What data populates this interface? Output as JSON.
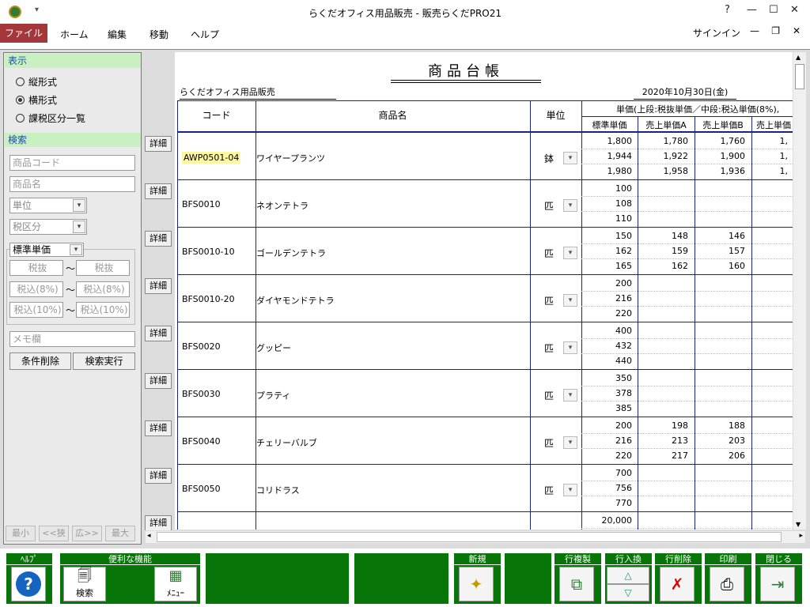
{
  "app": {
    "title": "らくだオフィス用品販売 - 販売らくだPRO21"
  },
  "ribbon": {
    "tabs": [
      "ファイル",
      "ホーム",
      "編集",
      "移動",
      "ヘルプ"
    ],
    "signin": "サインイン"
  },
  "sidebar": {
    "display_header": "表示",
    "display_options": [
      "縦形式",
      "横形式",
      "課税区分一覧"
    ],
    "search_header": "検索",
    "code_ph": "商品コード",
    "name_ph": "商品名",
    "unit_ph": "単位",
    "tax_ph": "税区分",
    "price_type": "標準単価",
    "tax_excl": "税抜",
    "tax8": "税込(8%)",
    "tax10": "税込(10%)",
    "tilde": "〜",
    "memo_ph": "メモ欄",
    "clear": "条件削除",
    "execute": "検索実行",
    "nav": [
      "最小",
      "<<狭",
      "広>>",
      "最大"
    ]
  },
  "doc": {
    "title": "商品台帳",
    "company": "らくだオフィス用品販売",
    "date": "2020年10月30日(金)",
    "h_code": "コード",
    "h_name": "商品名",
    "h_unit": "単位",
    "h_price": "単価(上段:税抜単価／中段:税込単価(8%),",
    "h_std": "標準単価",
    "h_a": "売上単価A",
    "h_b": "売上単価B",
    "h_c": "売上単価",
    "detail": "詳細",
    "rows": [
      {
        "code": "AWP0501-04",
        "name": "ワイヤープランツ",
        "unit": "鉢",
        "std": [
          "1,800",
          "1,944",
          "1,980"
        ],
        "a": [
          "1,780",
          "1,922",
          "1,958"
        ],
        "b": [
          "1,760",
          "1,900",
          "1,936"
        ],
        "c": [
          "1,",
          "1,",
          "1,"
        ]
      },
      {
        "code": "BFS0010",
        "name": "ネオンテトラ",
        "unit": "匹",
        "std": [
          "100",
          "108",
          "110"
        ],
        "a": [
          "",
          "",
          ""
        ],
        "b": [
          "",
          "",
          ""
        ],
        "c": [
          "",
          "",
          ""
        ]
      },
      {
        "code": "BFS0010-10",
        "name": "ゴールデンテトラ",
        "unit": "匹",
        "std": [
          "150",
          "162",
          "165"
        ],
        "a": [
          "148",
          "159",
          "162"
        ],
        "b": [
          "146",
          "157",
          "160"
        ],
        "c": [
          "",
          "",
          ""
        ]
      },
      {
        "code": "BFS0010-20",
        "name": "ダイヤモンドテトラ",
        "unit": "匹",
        "std": [
          "200",
          "216",
          "220"
        ],
        "a": [
          "",
          "",
          ""
        ],
        "b": [
          "",
          "",
          ""
        ],
        "c": [
          "",
          "",
          ""
        ]
      },
      {
        "code": "BFS0020",
        "name": "グッピー",
        "unit": "匹",
        "std": [
          "400",
          "432",
          "440"
        ],
        "a": [
          "",
          "",
          ""
        ],
        "b": [
          "",
          "",
          ""
        ],
        "c": [
          "",
          "",
          ""
        ]
      },
      {
        "code": "BFS0030",
        "name": "プラティ",
        "unit": "匹",
        "std": [
          "350",
          "378",
          "385"
        ],
        "a": [
          "",
          "",
          ""
        ],
        "b": [
          "",
          "",
          ""
        ],
        "c": [
          "",
          "",
          ""
        ]
      },
      {
        "code": "BFS0040",
        "name": "チェリーバルブ",
        "unit": "匹",
        "std": [
          "200",
          "216",
          "220"
        ],
        "a": [
          "198",
          "213",
          "217"
        ],
        "b": [
          "188",
          "203",
          "206"
        ],
        "c": [
          "",
          "",
          ""
        ]
      },
      {
        "code": "BFS0050",
        "name": "コリドラス",
        "unit": "匹",
        "std": [
          "700",
          "756",
          "770"
        ],
        "a": [
          "",
          "",
          ""
        ],
        "b": [
          "",
          "",
          ""
        ],
        "c": [
          "",
          "",
          ""
        ]
      },
      {
        "code": "",
        "name": "",
        "unit": "",
        "std": [
          "20,000",
          "",
          ""
        ],
        "a": [
          "",
          "",
          ""
        ],
        "b": [
          "",
          "",
          ""
        ],
        "c": [
          "",
          "",
          ""
        ]
      }
    ]
  },
  "bottombar": {
    "help": "ﾍﾙﾌﾟ",
    "tools": "便利な機能",
    "search": "検索",
    "menu": "ﾒﾆｭｰ",
    "new": "新規",
    "copy": "行複製",
    "swap": "行入換",
    "del": "行削除",
    "print": "印刷",
    "close": "閉じる"
  }
}
